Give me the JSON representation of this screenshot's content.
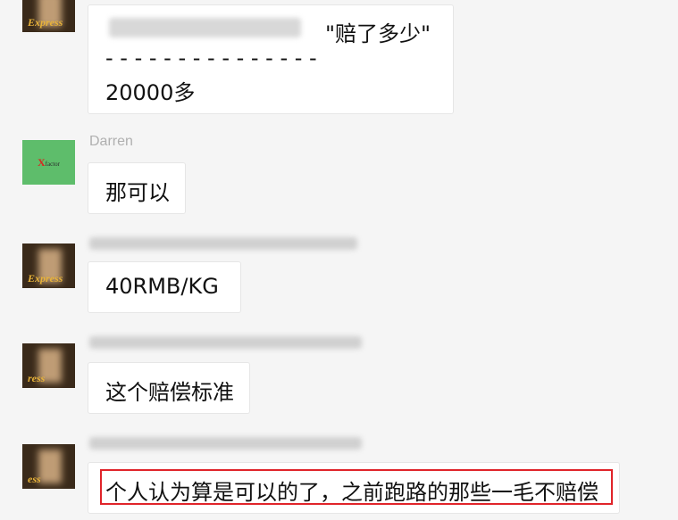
{
  "messages": [
    {
      "sender": "",
      "avatar_icon": "express-avatar-icon",
      "avatar_badge": "Express",
      "lines": [
        "\"赔了多少\"",
        "- - - - - - - - - - - - - - -",
        "20000多"
      ]
    },
    {
      "sender": "Darren",
      "avatar_icon": "x-factor-avatar-icon",
      "avatar_logo": "X",
      "avatar_logo_sub": "factor",
      "lines": [
        "那可以"
      ]
    },
    {
      "sender": "",
      "avatar_icon": "express-avatar-icon",
      "avatar_badge": "Express",
      "lines": [
        "40RMB/KG"
      ]
    },
    {
      "sender": "",
      "avatar_icon": "express-avatar-icon",
      "avatar_badge": "ress",
      "lines": [
        "这个赔偿标准"
      ]
    },
    {
      "sender": "",
      "avatar_icon": "express-avatar-icon",
      "avatar_badge": "ess",
      "lines": [
        "个人认为算是可以的了，之前跑路的那些一毛不赔偿"
      ]
    }
  ],
  "colors": {
    "background": "#f5f5f5",
    "bubble": "#ffffff",
    "highlight": "#e0242a",
    "sender_name": "#b0b0b0"
  }
}
